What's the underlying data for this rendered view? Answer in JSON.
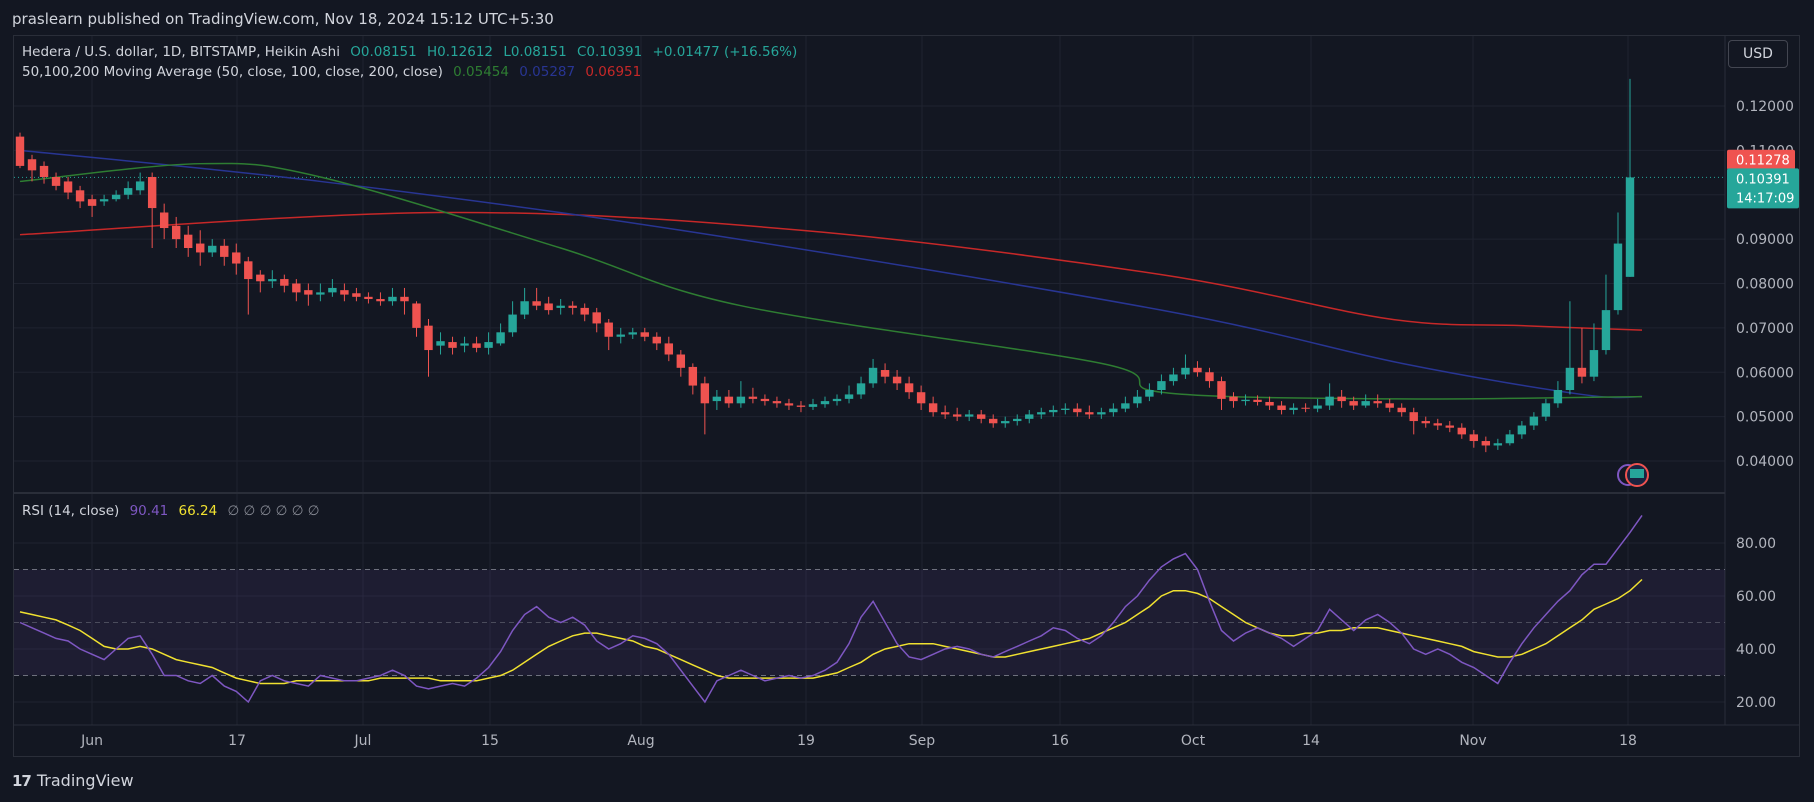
{
  "header": {
    "published": "praslearn published on TradingView.com, Nov 18, 2024 15:12 UTC+5:30"
  },
  "legend": {
    "symbol": "Hedera / U.S. dollar, 1D, BITSTAMP, Heikin Ashi",
    "o": "O0.08151",
    "h": "H0.12612",
    "l": "L0.08151",
    "c": "C0.10391",
    "change": "+0.01477 (+16.56%)",
    "ma_label": "50,100,200 Moving Average (50, close, 100, close, 200, close)",
    "ma50": "0.05454",
    "ma100": "0.05287",
    "ma200": "0.06951",
    "rsi_label": "RSI (14, close)",
    "rsi_value": "90.41",
    "rsi_ma": "66.24",
    "rsi_nulls": "∅ ∅ ∅ ∅ ∅ ∅"
  },
  "currency": "USD",
  "footer": {
    "brand": "TradingView"
  },
  "colors": {
    "up": "#26a69a",
    "down": "#ef5350",
    "ma50": "#2e7d32",
    "ma100": "#283593",
    "ma200": "#c62828",
    "rsi": "#7e57c2",
    "rsi_ma": "#f0e130"
  },
  "chart_data": [
    {
      "type": "candlestick",
      "title": "Hedera / U.S. dollar, 1D, BITSTAMP, Heikin Ashi",
      "x_ticks": [
        "Jun",
        "17",
        "Jul",
        "15",
        "Aug",
        "19",
        "Sep",
        "16",
        "Oct",
        "14",
        "Nov",
        "18"
      ],
      "y_ticks": [
        "0.04000",
        "0.05000",
        "0.06000",
        "0.07000",
        "0.08000",
        "0.09000",
        "0.11000",
        "0.12000"
      ],
      "ylim": [
        0.033,
        0.125
      ],
      "price_labels": {
        "ma200": "0.11278",
        "last": "0.10391",
        "countdown": "14:17:09"
      },
      "candles": [
        [
          0.1131,
          0.1065,
          0.114,
          0.106
        ],
        [
          0.108,
          0.1055,
          0.109,
          0.103
        ],
        [
          0.1065,
          0.104,
          0.1075,
          0.1025
        ],
        [
          0.104,
          0.102,
          0.105,
          0.101
        ],
        [
          0.103,
          0.1005,
          0.104,
          0.099
        ],
        [
          0.101,
          0.0985,
          0.102,
          0.097
        ],
        [
          0.099,
          0.0975,
          0.1,
          0.095
        ],
        [
          0.0985,
          0.099,
          0.1,
          0.0975
        ],
        [
          0.099,
          0.1,
          0.101,
          0.0985
        ],
        [
          0.1,
          0.1015,
          0.103,
          0.099
        ],
        [
          0.101,
          0.103,
          0.105,
          0.1
        ],
        [
          0.104,
          0.097,
          0.105,
          0.088
        ],
        [
          0.096,
          0.0925,
          0.098,
          0.09
        ],
        [
          0.093,
          0.09,
          0.095,
          0.088
        ],
        [
          0.091,
          0.088,
          0.093,
          0.086
        ],
        [
          0.089,
          0.087,
          0.092,
          0.084
        ],
        [
          0.087,
          0.0885,
          0.09,
          0.086
        ],
        [
          0.0885,
          0.086,
          0.09,
          0.084
        ],
        [
          0.087,
          0.0845,
          0.089,
          0.082
        ],
        [
          0.085,
          0.081,
          0.086,
          0.073
        ],
        [
          0.082,
          0.0805,
          0.083,
          0.078
        ],
        [
          0.0805,
          0.081,
          0.083,
          0.079
        ],
        [
          0.081,
          0.0795,
          0.082,
          0.078
        ],
        [
          0.08,
          0.078,
          0.081,
          0.076
        ],
        [
          0.0785,
          0.0775,
          0.08,
          0.075
        ],
        [
          0.0775,
          0.078,
          0.08,
          0.076
        ],
        [
          0.078,
          0.079,
          0.081,
          0.077
        ],
        [
          0.0785,
          0.0775,
          0.08,
          0.076
        ],
        [
          0.0778,
          0.077,
          0.079,
          0.076
        ],
        [
          0.077,
          0.0765,
          0.078,
          0.0755
        ],
        [
          0.0765,
          0.076,
          0.078,
          0.075
        ],
        [
          0.076,
          0.077,
          0.079,
          0.075
        ],
        [
          0.077,
          0.076,
          0.079,
          0.073
        ],
        [
          0.0755,
          0.07,
          0.076,
          0.068
        ],
        [
          0.0705,
          0.065,
          0.072,
          0.059
        ],
        [
          0.066,
          0.067,
          0.069,
          0.064
        ],
        [
          0.0668,
          0.0655,
          0.068,
          0.064
        ],
        [
          0.066,
          0.0665,
          0.068,
          0.0645
        ],
        [
          0.0665,
          0.0655,
          0.068,
          0.0645
        ],
        [
          0.0655,
          0.0668,
          0.069,
          0.064
        ],
        [
          0.0665,
          0.069,
          0.071,
          0.066
        ],
        [
          0.069,
          0.073,
          0.076,
          0.068
        ],
        [
          0.073,
          0.076,
          0.079,
          0.072
        ],
        [
          0.076,
          0.075,
          0.079,
          0.074
        ],
        [
          0.0755,
          0.074,
          0.077,
          0.073
        ],
        [
          0.0745,
          0.075,
          0.0765,
          0.073
        ],
        [
          0.075,
          0.0745,
          0.076,
          0.073
        ],
        [
          0.0745,
          0.073,
          0.0755,
          0.0715
        ],
        [
          0.0735,
          0.071,
          0.0745,
          0.069
        ],
        [
          0.0712,
          0.068,
          0.072,
          0.065
        ],
        [
          0.068,
          0.0685,
          0.07,
          0.0665
        ],
        [
          0.0685,
          0.069,
          0.07,
          0.0675
        ],
        [
          0.069,
          0.068,
          0.07,
          0.067
        ],
        [
          0.068,
          0.0665,
          0.069,
          0.065
        ],
        [
          0.0665,
          0.064,
          0.068,
          0.0625
        ],
        [
          0.064,
          0.061,
          0.065,
          0.059
        ],
        [
          0.0612,
          0.057,
          0.062,
          0.055
        ],
        [
          0.0575,
          0.053,
          0.059,
          0.046
        ],
        [
          0.0535,
          0.0545,
          0.056,
          0.0515
        ],
        [
          0.0545,
          0.053,
          0.056,
          0.052
        ],
        [
          0.053,
          0.0545,
          0.058,
          0.052
        ],
        [
          0.0545,
          0.054,
          0.0565,
          0.053
        ],
        [
          0.054,
          0.0535,
          0.055,
          0.0525
        ],
        [
          0.0535,
          0.053,
          0.0545,
          0.052
        ],
        [
          0.053,
          0.0525,
          0.054,
          0.0515
        ],
        [
          0.0525,
          0.0522,
          0.0535,
          0.051
        ],
        [
          0.0522,
          0.0528,
          0.054,
          0.0515
        ],
        [
          0.0528,
          0.0535,
          0.0545,
          0.052
        ],
        [
          0.0535,
          0.054,
          0.055,
          0.0525
        ],
        [
          0.054,
          0.055,
          0.057,
          0.053
        ],
        [
          0.055,
          0.0575,
          0.059,
          0.054
        ],
        [
          0.0575,
          0.061,
          0.063,
          0.0565
        ],
        [
          0.0605,
          0.059,
          0.062,
          0.0575
        ],
        [
          0.059,
          0.0575,
          0.0605,
          0.056
        ],
        [
          0.0575,
          0.0555,
          0.059,
          0.054
        ],
        [
          0.0555,
          0.053,
          0.057,
          0.0515
        ],
        [
          0.053,
          0.051,
          0.0545,
          0.05
        ],
        [
          0.051,
          0.0505,
          0.0525,
          0.0495
        ],
        [
          0.0505,
          0.05,
          0.052,
          0.049
        ],
        [
          0.05,
          0.0505,
          0.0515,
          0.049
        ],
        [
          0.0505,
          0.0495,
          0.0515,
          0.0485
        ],
        [
          0.0495,
          0.0485,
          0.0505,
          0.0475
        ],
        [
          0.0485,
          0.049,
          0.05,
          0.0475
        ],
        [
          0.049,
          0.0495,
          0.0505,
          0.048
        ],
        [
          0.0495,
          0.0505,
          0.0515,
          0.0485
        ],
        [
          0.0505,
          0.051,
          0.052,
          0.0495
        ],
        [
          0.051,
          0.0515,
          0.0525,
          0.05
        ],
        [
          0.0515,
          0.0518,
          0.053,
          0.0505
        ],
        [
          0.0518,
          0.051,
          0.053,
          0.05
        ],
        [
          0.051,
          0.0505,
          0.0525,
          0.0495
        ],
        [
          0.0505,
          0.051,
          0.052,
          0.0495
        ],
        [
          0.051,
          0.0518,
          0.053,
          0.05
        ],
        [
          0.0518,
          0.053,
          0.0545,
          0.051
        ],
        [
          0.053,
          0.0545,
          0.056,
          0.052
        ],
        [
          0.0545,
          0.056,
          0.0575,
          0.0535
        ],
        [
          0.056,
          0.058,
          0.0595,
          0.055
        ],
        [
          0.058,
          0.0595,
          0.061,
          0.057
        ],
        [
          0.0595,
          0.061,
          0.064,
          0.0585
        ],
        [
          0.061,
          0.06,
          0.0625,
          0.059
        ],
        [
          0.06,
          0.058,
          0.061,
          0.0565
        ],
        [
          0.058,
          0.054,
          0.059,
          0.0515
        ],
        [
          0.0545,
          0.0535,
          0.0555,
          0.052
        ],
        [
          0.0535,
          0.0538,
          0.055,
          0.0525
        ],
        [
          0.0538,
          0.0533,
          0.0548,
          0.0525
        ],
        [
          0.0533,
          0.0525,
          0.0545,
          0.0515
        ],
        [
          0.0525,
          0.0515,
          0.0535,
          0.0505
        ],
        [
          0.0515,
          0.052,
          0.053,
          0.0505
        ],
        [
          0.052,
          0.0518,
          0.053,
          0.051
        ],
        [
          0.0518,
          0.0525,
          0.054,
          0.051
        ],
        [
          0.0525,
          0.0545,
          0.0575,
          0.0515
        ],
        [
          0.0545,
          0.0535,
          0.056,
          0.052
        ],
        [
          0.0535,
          0.0525,
          0.0545,
          0.0515
        ],
        [
          0.0525,
          0.0535,
          0.055,
          0.052
        ],
        [
          0.0535,
          0.053,
          0.055,
          0.052
        ],
        [
          0.053,
          0.052,
          0.054,
          0.051
        ],
        [
          0.052,
          0.051,
          0.053,
          0.05
        ],
        [
          0.051,
          0.049,
          0.052,
          0.046
        ],
        [
          0.049,
          0.0485,
          0.05,
          0.0475
        ],
        [
          0.0485,
          0.048,
          0.0495,
          0.047
        ],
        [
          0.048,
          0.0475,
          0.049,
          0.0465
        ],
        [
          0.0475,
          0.046,
          0.0485,
          0.045
        ],
        [
          0.046,
          0.0445,
          0.047,
          0.043
        ],
        [
          0.0445,
          0.0435,
          0.0455,
          0.042
        ],
        [
          0.0435,
          0.044,
          0.045,
          0.0425
        ],
        [
          0.044,
          0.046,
          0.047,
          0.0435
        ],
        [
          0.046,
          0.048,
          0.049,
          0.045
        ],
        [
          0.048,
          0.05,
          0.051,
          0.047
        ],
        [
          0.05,
          0.053,
          0.054,
          0.049
        ],
        [
          0.053,
          0.056,
          0.058,
          0.052
        ],
        [
          0.056,
          0.061,
          0.076,
          0.055
        ],
        [
          0.061,
          0.059,
          0.07,
          0.0575
        ],
        [
          0.059,
          0.065,
          0.071,
          0.058
        ],
        [
          0.065,
          0.074,
          0.082,
          0.064
        ],
        [
          0.074,
          0.089,
          0.096,
          0.073
        ],
        [
          0.0815,
          0.1039,
          0.1261,
          0.0815
        ]
      ],
      "ma50_path": [
        [
          0,
          0.103
        ],
        [
          15,
          0.107
        ],
        [
          25,
          0.104
        ],
        [
          45,
          0.088
        ],
        [
          60,
          0.075
        ],
        [
          90,
          0.062
        ],
        [
          95,
          0.0555
        ],
        [
          114,
          0.054
        ],
        [
          135,
          0.0545
        ]
      ],
      "ma100_path": [
        [
          0,
          0.11
        ],
        [
          25,
          0.103
        ],
        [
          55,
          0.092
        ],
        [
          95,
          0.074
        ],
        [
          115,
          0.062
        ],
        [
          130,
          0.055
        ],
        [
          135,
          0.0545
        ]
      ],
      "ma200_path": [
        [
          0,
          0.091
        ],
        [
          35,
          0.096
        ],
        [
          65,
          0.092
        ],
        [
          95,
          0.082
        ],
        [
          114,
          0.072
        ],
        [
          125,
          0.0705
        ],
        [
          135,
          0.0695
        ]
      ]
    },
    {
      "type": "line",
      "title": "RSI (14, close)",
      "y_ticks": [
        "80.00",
        "60.00",
        "40.00",
        "20.00"
      ],
      "ylim": [
        10,
        95
      ],
      "bands": {
        "upper": 70,
        "middle": 50,
        "lower": 30
      },
      "series": [
        {
          "name": "RSI",
          "values": [
            50,
            48,
            46,
            44,
            43,
            40,
            38,
            36,
            40,
            44,
            45,
            38,
            30,
            30,
            28,
            27,
            30,
            26,
            24,
            20,
            28,
            30,
            28,
            27,
            26,
            30,
            29,
            28,
            28,
            29,
            30,
            32,
            30,
            26,
            25,
            26,
            27,
            26,
            29,
            33,
            39,
            47,
            53,
            56,
            52,
            50,
            52,
            49,
            43,
            40,
            42,
            45,
            44,
            42,
            38,
            32,
            26,
            20,
            28,
            30,
            32,
            30,
            28,
            29,
            30,
            29,
            30,
            32,
            35,
            42,
            52,
            58,
            50,
            42,
            37,
            36,
            38,
            40,
            41,
            40,
            38,
            37,
            39,
            41,
            43,
            45,
            48,
            47,
            44,
            42,
            45,
            50,
            56,
            60,
            66,
            71,
            74,
            76,
            70,
            58,
            47,
            43,
            46,
            48,
            46,
            44,
            41,
            44,
            47,
            55,
            51,
            47,
            51,
            53,
            50,
            46,
            40,
            38,
            40,
            38,
            35,
            33,
            30,
            27,
            35,
            42,
            48,
            53,
            58,
            62,
            68,
            72,
            72,
            78,
            84,
            90.41
          ]
        },
        {
          "name": "RSI MA",
          "values": [
            54,
            53,
            52,
            51,
            49,
            47,
            44,
            41,
            40,
            40,
            41,
            40,
            38,
            36,
            35,
            34,
            33,
            31,
            29,
            28,
            27,
            27,
            27,
            28,
            28,
            28,
            28,
            28,
            28,
            28,
            29,
            29,
            29,
            29,
            29,
            28,
            28,
            28,
            28,
            29,
            30,
            32,
            35,
            38,
            41,
            43,
            45,
            46,
            46,
            45,
            44,
            43,
            41,
            40,
            38,
            36,
            34,
            32,
            30,
            29,
            29,
            29,
            29,
            29,
            29,
            29,
            29,
            30,
            31,
            33,
            35,
            38,
            40,
            41,
            42,
            42,
            42,
            41,
            40,
            39,
            38,
            37,
            37,
            38,
            39,
            40,
            41,
            42,
            43,
            44,
            46,
            48,
            50,
            53,
            56,
            60,
            62,
            62,
            61,
            59,
            56,
            53,
            50,
            48,
            46,
            45,
            45,
            46,
            46,
            47,
            47,
            48,
            48,
            48,
            47,
            46,
            45,
            44,
            43,
            42,
            41,
            39,
            38,
            37,
            37,
            38,
            40,
            42,
            45,
            48,
            51,
            55,
            57,
            59,
            62,
            66.24
          ]
        }
      ]
    }
  ]
}
